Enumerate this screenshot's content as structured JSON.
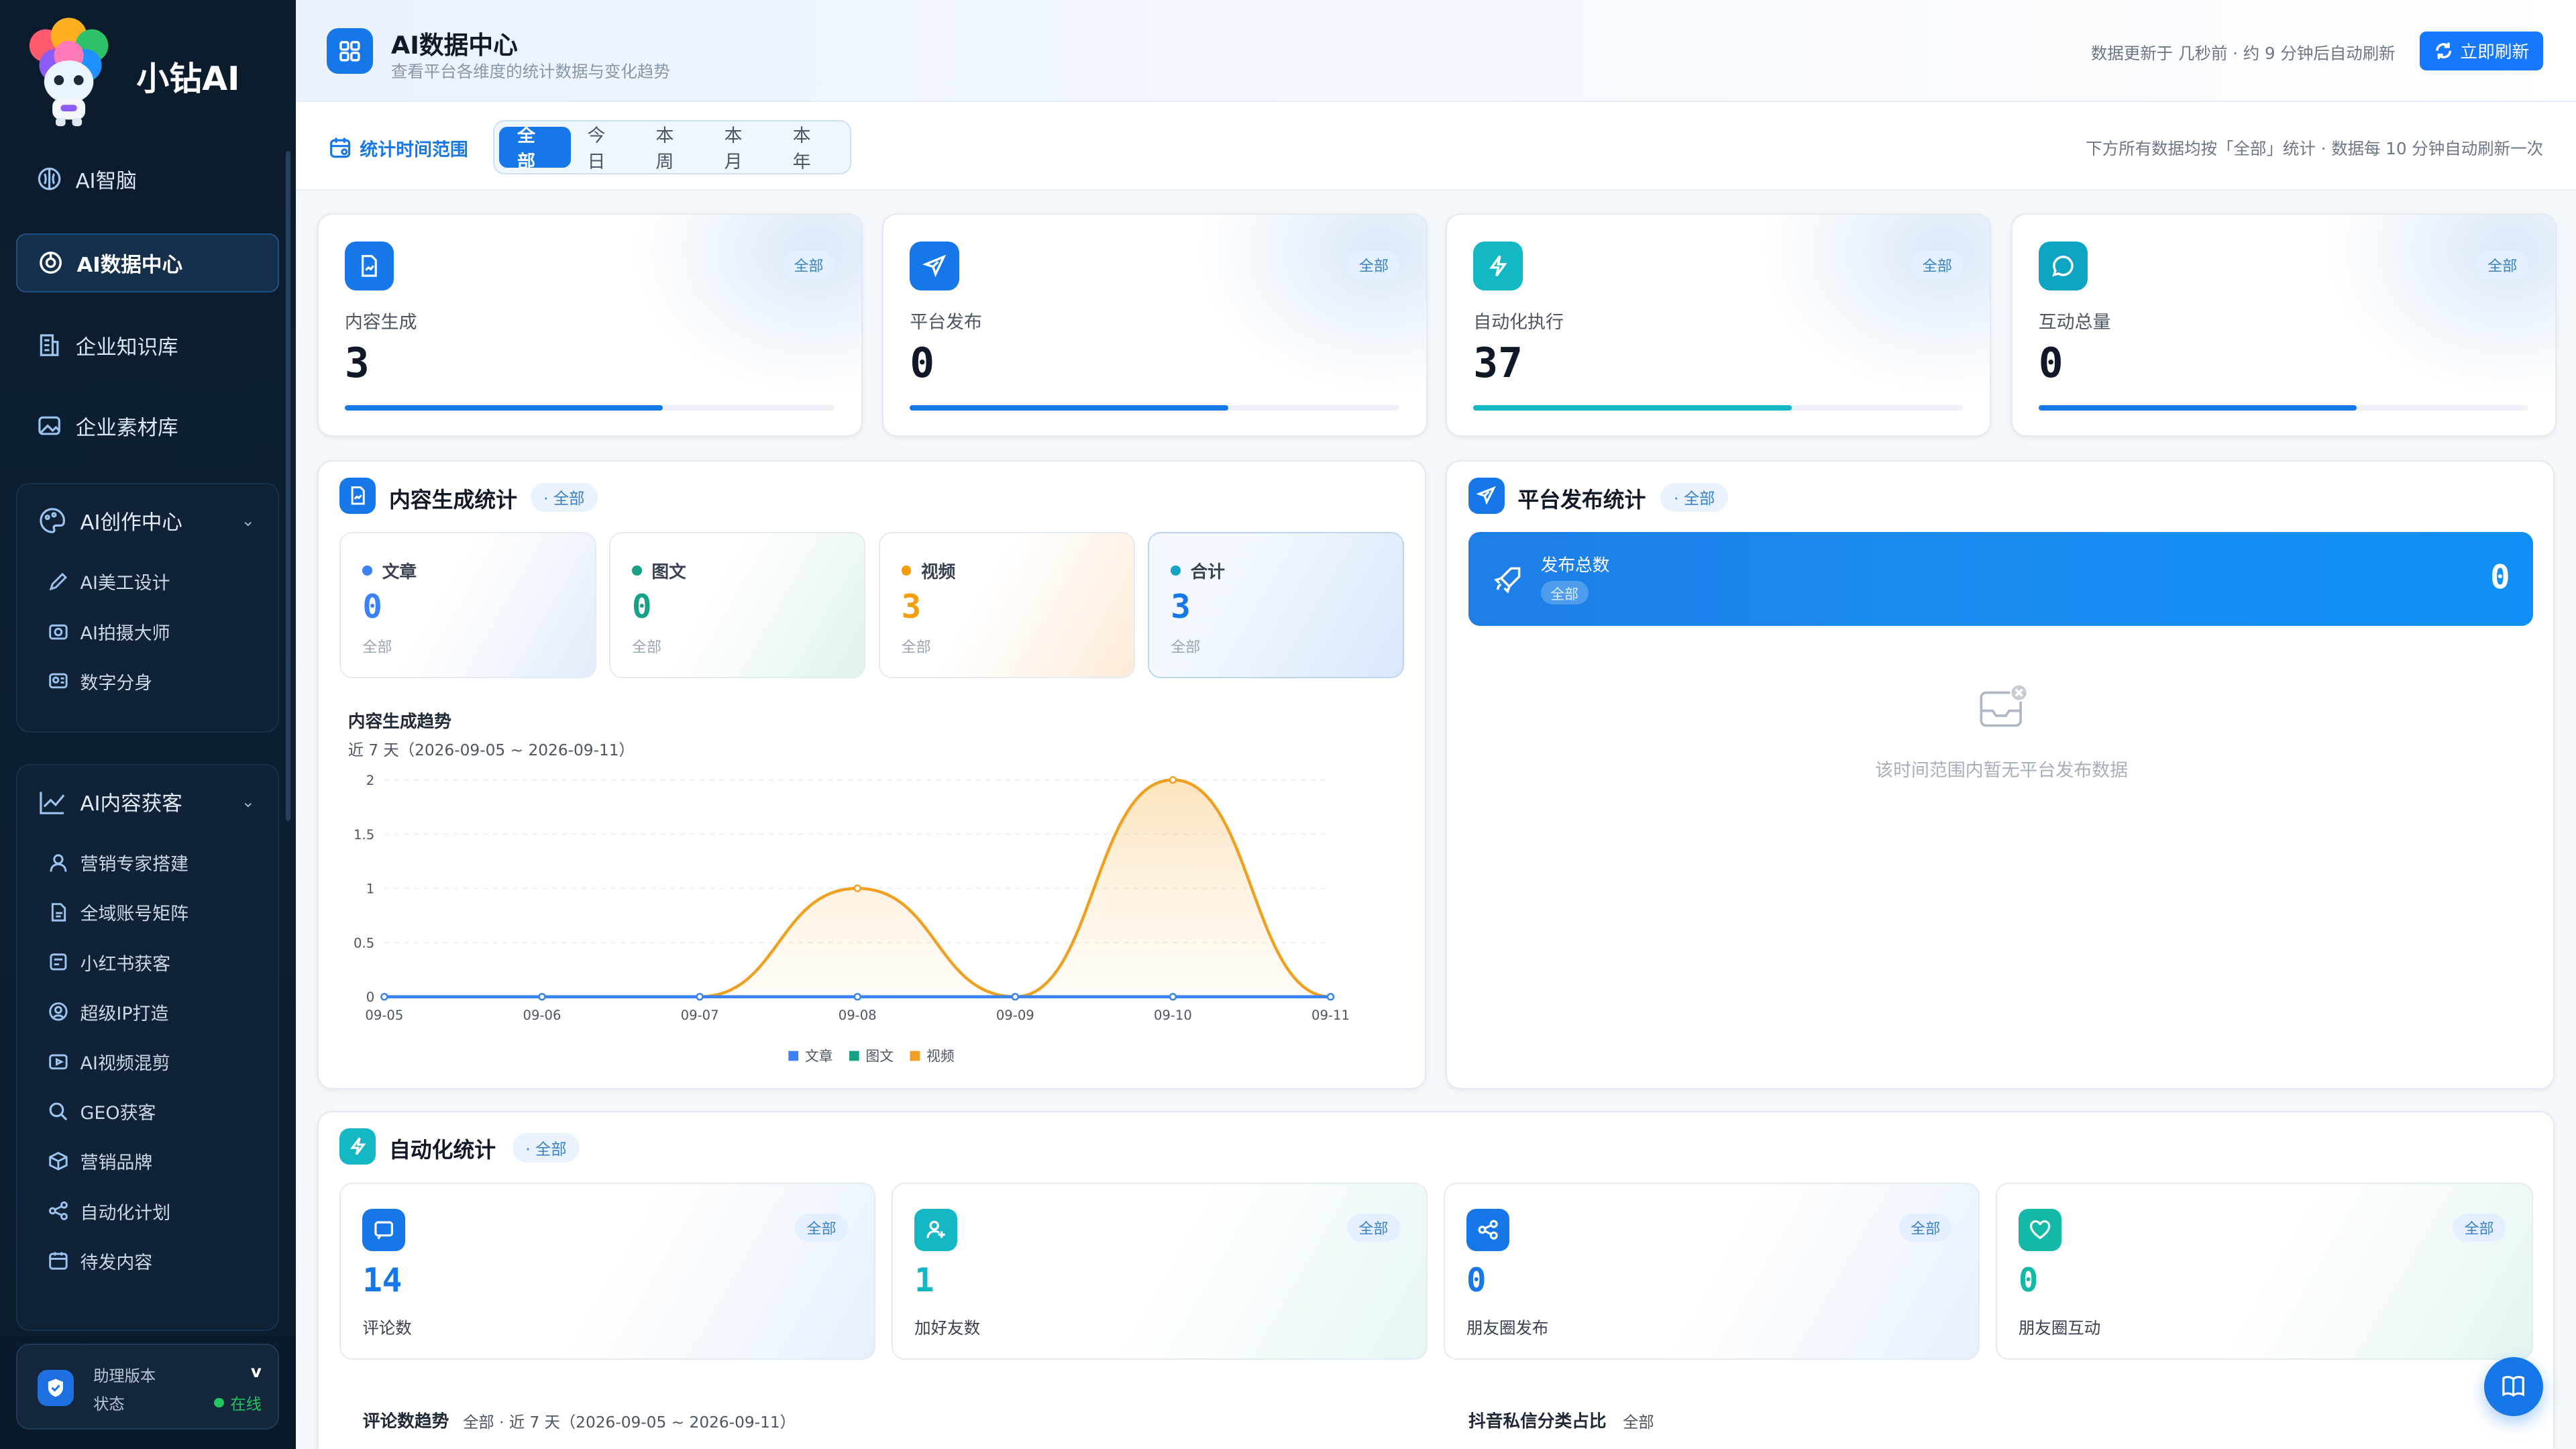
{
  "sidebar": {
    "brand": "小钻AI",
    "nav": [
      {
        "label": "AI智脑",
        "icon": "brain-icon"
      },
      {
        "label": "AI数据中心",
        "icon": "data-center-icon",
        "active": true
      },
      {
        "label": "企业知识库",
        "icon": "building-icon"
      },
      {
        "label": "企业素材库",
        "icon": "image-icon"
      }
    ],
    "groups": [
      {
        "label": "AI创作中心",
        "icon": "palette-icon",
        "items": [
          "AI美工设计",
          "AI拍摄大师",
          "数字分身"
        ]
      },
      {
        "label": "AI内容获客",
        "icon": "trend-icon",
        "items": [
          "营销专家搭建",
          "全域账号矩阵",
          "小红书获客",
          "超级IP打造",
          "AI视频混剪",
          "GEO获客",
          "营销品牌",
          "自动化计划",
          "待发内容"
        ]
      }
    ],
    "version": {
      "label": "助理版本",
      "value": "v",
      "status_label": "状态",
      "status": "在线"
    }
  },
  "header": {
    "title": "AI数据中心",
    "subtitle": "查看平台各维度的统计数据与变化趋势",
    "update": "数据更新于 几秒前 · 约 9 分钟后自动刷新",
    "refresh": "立即刷新"
  },
  "filter": {
    "label": "统计时间范围",
    "options": [
      "全部",
      "今日",
      "本周",
      "本月",
      "本年"
    ],
    "selected": "全部",
    "note": "下方所有数据均按「全部」统计 · 数据每 10 分钟自动刷新一次"
  },
  "kpis": [
    {
      "label": "内容生成",
      "value": "3",
      "tag": "全部",
      "progress": 0.65,
      "color": "#1677e8",
      "icon": "document-icon"
    },
    {
      "label": "平台发布",
      "value": "0",
      "tag": "全部",
      "progress": 0.65,
      "color": "#1677e8",
      "icon": "send-icon"
    },
    {
      "label": "自动化执行",
      "value": "37",
      "tag": "全部",
      "progress": 0.65,
      "color": "#14b8c4",
      "icon": "lightning-icon"
    },
    {
      "label": "互动总量",
      "value": "0",
      "tag": "全部",
      "progress": 0.65,
      "color": "#1677e8",
      "icon": "chat-icon"
    }
  ],
  "content_stats": {
    "title": "内容生成统计",
    "tag": "· 全部",
    "items": [
      {
        "label": "文章",
        "value": "0",
        "sub": "全部",
        "color": "#3b82f6"
      },
      {
        "label": "图文",
        "value": "0",
        "sub": "全部",
        "color": "#16a085"
      },
      {
        "label": "视频",
        "value": "3",
        "sub": "全部",
        "color": "#f59e0b"
      },
      {
        "label": "合计",
        "value": "3",
        "sub": "全部",
        "color": "#1677e8"
      }
    ],
    "trend_title": "内容生成趋势",
    "trend_range": "近 7 天（2026-09-05 ~ 2026-09-11）"
  },
  "chart_data": {
    "type": "line",
    "title": "内容生成趋势",
    "categories": [
      "09-05",
      "09-06",
      "09-07",
      "09-08",
      "09-09",
      "09-10",
      "09-11"
    ],
    "yticks": [
      "2",
      "1.5",
      "1",
      "0.5",
      "0"
    ],
    "ylim": [
      0,
      2
    ],
    "series": [
      {
        "name": "文章",
        "values": [
          0,
          0,
          0,
          0,
          0,
          0,
          0
        ],
        "color": "#3b82f6"
      },
      {
        "name": "图文",
        "values": [
          0,
          0,
          0,
          0,
          0,
          0,
          0
        ],
        "color": "#16a085"
      },
      {
        "name": "视频",
        "values": [
          0,
          0,
          0,
          1,
          0,
          2,
          0
        ],
        "color": "#f0a020"
      }
    ],
    "legend": "bottom"
  },
  "publish": {
    "title": "平台发布统计",
    "tag": "· 全部",
    "banner_label": "发布总数",
    "banner_tag": "全部",
    "banner_value": "0",
    "empty": "该时间范围内暂无平台发布数据"
  },
  "automation": {
    "title": "自动化统计",
    "tag": "· 全部",
    "items": [
      {
        "label": "评论数",
        "value": "14",
        "tag": "全部",
        "color": "#1677e8",
        "icon": "comment-icon"
      },
      {
        "label": "加好友数",
        "value": "1",
        "tag": "全部",
        "color": "#14b8c4",
        "icon": "add-user-icon"
      },
      {
        "label": "朋友圈发布",
        "value": "0",
        "tag": "全部",
        "color": "#1677e8",
        "icon": "share-icon"
      },
      {
        "label": "朋友圈互动",
        "value": "0",
        "tag": "全部",
        "color": "#14b8a6",
        "icon": "heart-icon"
      }
    ],
    "comment_trend_title": "评论数趋势",
    "comment_trend_sub": "全部 · 近 7 天（2026-09-05 ~ 2026-09-11）",
    "douyin_title": "抖音私信分类占比",
    "douyin_sub": "全部"
  }
}
